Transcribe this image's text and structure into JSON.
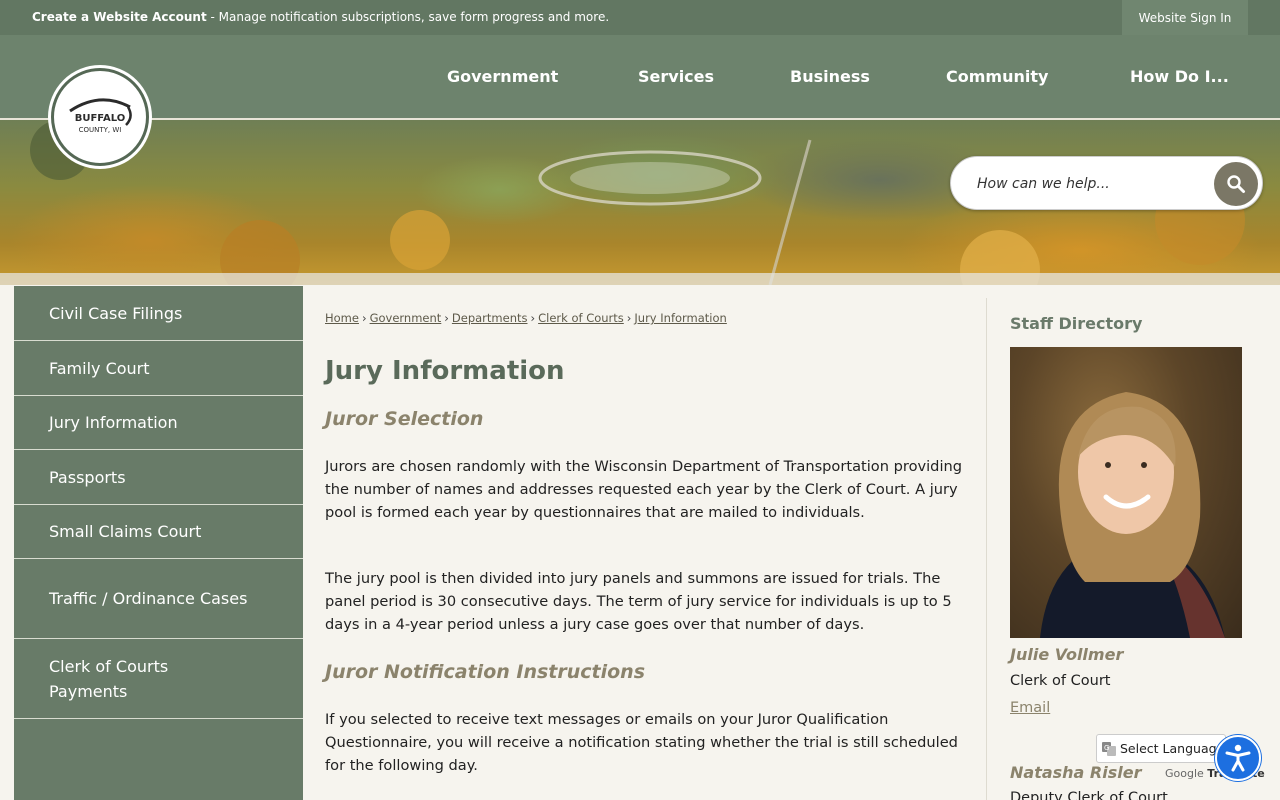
{
  "topbar": {
    "account_link": "Create a Website Account",
    "account_text": " - Manage notification subscriptions, save form progress and more.",
    "signin": "Website Sign In"
  },
  "nav": {
    "items": [
      "Government",
      "Services",
      "Business",
      "Community",
      "How Do I..."
    ]
  },
  "logo": {
    "line1": "BUFFALO",
    "line2": "COUNTY, WI"
  },
  "search": {
    "placeholder": "How can we help...",
    "icon": "search-icon"
  },
  "sidebar": {
    "items": [
      {
        "label": "Civil Case Filings"
      },
      {
        "label": "Family Court"
      },
      {
        "label": "Jury Information"
      },
      {
        "label": "Passports"
      },
      {
        "label": "Small Claims Court"
      },
      {
        "label": "Traffic / Ordinance Cases"
      },
      {
        "label": "Clerk of Courts Payments"
      }
    ]
  },
  "breadcrumb": [
    "Home",
    "Government",
    "Departments",
    "Clerk of Courts",
    "Jury Information"
  ],
  "content": {
    "title": "Jury Information",
    "section1": "Juror Selection",
    "p1": "Jurors are chosen randomly with the Wisconsin Department of Transportation providing the number of names and addresses requested each year by the Clerk of Court. A jury pool is formed each year by questionnaires that are mailed to individuals.",
    "p2": "The jury pool is then divided into jury panels and summons are issued for trials. The panel period is 30 consecutive days. The term of jury service for individuals is up to 5 days in a 4-year period unless a jury case goes over that number of days.",
    "section2": "Juror Notification Instructions",
    "p3": "If you selected to receive text messages or emails on your Juror Qualification Questionnaire, you will receive a notification stating whether the trial is still scheduled for the following day."
  },
  "staff": {
    "title": "Staff Directory",
    "people": [
      {
        "name": "Julie Vollmer",
        "role": "Clerk of Court",
        "email": "Email"
      },
      {
        "name": "Natasha Risler",
        "role": "Deputy Clerk of Court"
      }
    ]
  },
  "translate": {
    "select_label": "Select Language",
    "google": "Google",
    "translate": "Translate"
  },
  "colors": {
    "header": "#6d836d",
    "topbar": "#627762",
    "sidebar": "#687b68",
    "accent": "#8b836c",
    "access": "#1d6fe0"
  }
}
